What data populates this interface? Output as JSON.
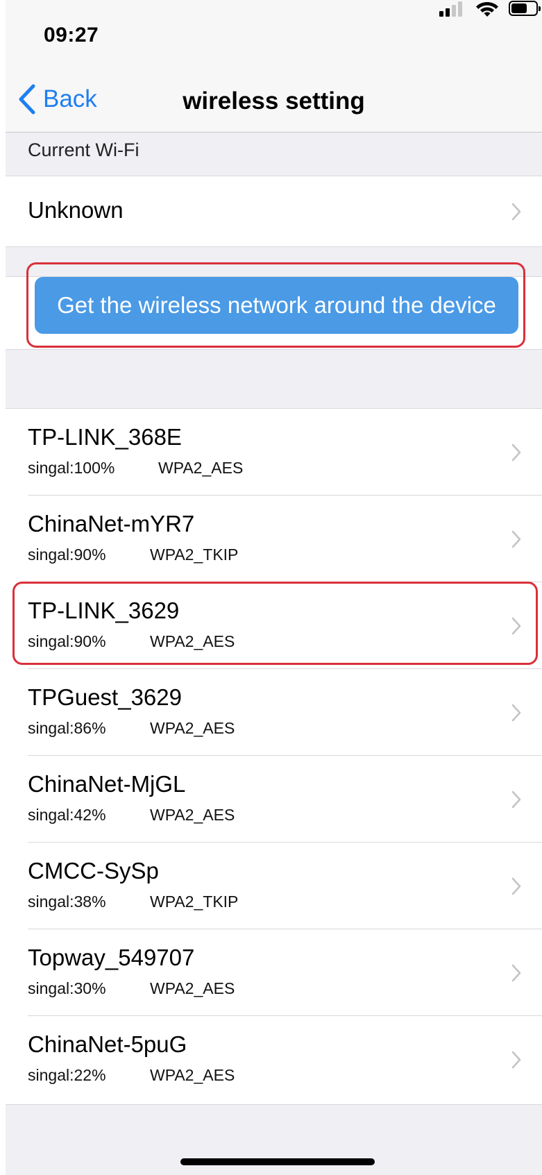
{
  "status_bar": {
    "time": "09:27",
    "icons": [
      "signal-icon",
      "wifi-icon",
      "battery-icon"
    ]
  },
  "nav": {
    "back_label": "Back",
    "title": "wireless setting"
  },
  "current_wifi": {
    "header": "Current Wi-Fi",
    "value": "Unknown"
  },
  "scan_button": {
    "label": "Get the wireless network around the device",
    "color": "#4a9ae6"
  },
  "networks": [
    {
      "name": "TP-LINK_368E",
      "signal": "singal:100%",
      "security": "WPA2_AES"
    },
    {
      "name": "ChinaNet-mYR7",
      "signal": "singal:90%",
      "security": "WPA2_TKIP"
    },
    {
      "name": "TP-LINK_3629",
      "signal": "singal:90%",
      "security": "WPA2_AES"
    },
    {
      "name": "TPGuest_3629",
      "signal": "singal:86%",
      "security": "WPA2_AES"
    },
    {
      "name": "ChinaNet-MjGL",
      "signal": "singal:42%",
      "security": "WPA2_AES"
    },
    {
      "name": "CMCC-SySp",
      "signal": "singal:38%",
      "security": "WPA2_TKIP"
    },
    {
      "name": "Topway_549707",
      "signal": "singal:30%",
      "security": "WPA2_AES"
    },
    {
      "name": "ChinaNet-5puG",
      "signal": "singal:22%",
      "security": "WPA2_AES"
    }
  ],
  "colors": {
    "accent": "#1e7ff0",
    "highlight_frame": "#d9303a"
  }
}
